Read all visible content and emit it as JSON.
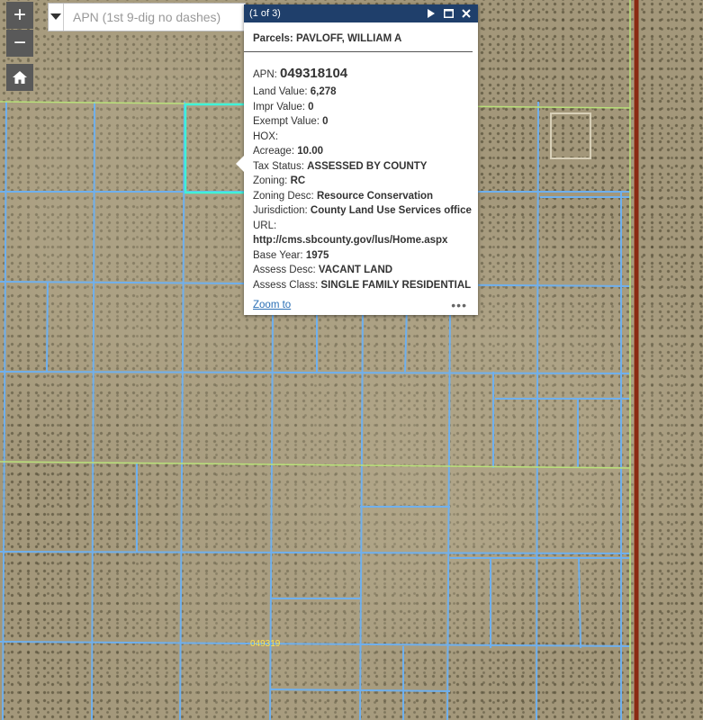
{
  "map": {
    "zoom_in": "+",
    "zoom_out": "−",
    "parcel_label": "049319",
    "colors": {
      "parcel_lines": "#6fb0ee",
      "section_lines": "#b9e27a",
      "selected_parcel": "#3ff2d9",
      "road": "#8a2a12"
    }
  },
  "search": {
    "placeholder": "APN (1st 9-dig no dashes)",
    "value": ""
  },
  "popup": {
    "counter": "(1 of 3)",
    "title": "Parcels: PAVLOFF, WILLIAM A",
    "apn_label": "APN:",
    "apn_value": "049318104",
    "fields": {
      "land_value": {
        "label": "Land Value:",
        "value": "6,278"
      },
      "impr_value": {
        "label": "Impr Value:",
        "value": "0"
      },
      "exempt_value": {
        "label": "Exempt Value:",
        "value": "0"
      },
      "hox": {
        "label": "HOX:",
        "value": ""
      },
      "acreage": {
        "label": "Acreage:",
        "value": "10.00"
      },
      "tax_status": {
        "label": "Tax Status:",
        "value": "ASSESSED BY COUNTY"
      },
      "zoning": {
        "label": "Zoning:",
        "value": "RC"
      },
      "zoning_desc": {
        "label": "Zoning Desc:",
        "value": "Resource Conservation"
      },
      "jurisdiction": {
        "label": "Jurisdiction:",
        "value": "County Land Use Services office"
      },
      "url": {
        "label": "URL:",
        "value": "http://cms.sbcounty.gov/lus/Home.aspx"
      },
      "base_year": {
        "label": "Base Year:",
        "value": "1975"
      },
      "assess_desc": {
        "label": "Assess Desc:",
        "value": "VACANT LAND"
      },
      "assess_class": {
        "label": "Assess Class:",
        "value": "SINGLE FAMILY RESIDENTIAL"
      }
    },
    "zoom_to": "Zoom to",
    "more": "•••"
  }
}
